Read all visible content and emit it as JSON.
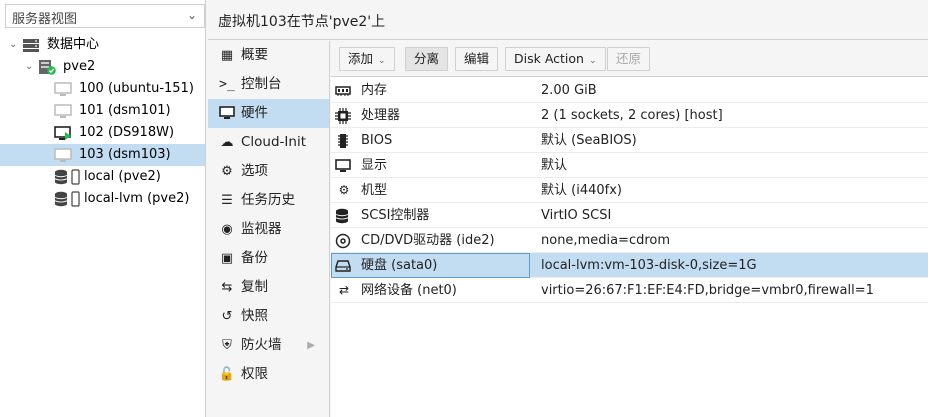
{
  "sidebar": {
    "view_select": "服务器视图",
    "tree": [
      {
        "label": "数据中心",
        "icon": "datacenter-icon",
        "level": 0,
        "expander": "minus"
      },
      {
        "label": "pve2",
        "icon": "node-online-icon",
        "level": 1,
        "expander": "minus"
      },
      {
        "label": "100 (ubuntu-151)",
        "icon": "vm-stopped-icon",
        "level": 2
      },
      {
        "label": "101 (dsm101)",
        "icon": "vm-stopped-icon",
        "level": 2
      },
      {
        "label": "102 (DS918W)",
        "icon": "vm-running-icon",
        "level": 2
      },
      {
        "label": "103 (dsm103)",
        "icon": "vm-stopped-icon",
        "level": 2,
        "selected": true
      },
      {
        "label": "local (pve2)",
        "icon": "storage-icon",
        "level": 2
      },
      {
        "label": "local-lvm (pve2)",
        "icon": "storage-icon",
        "level": 2
      }
    ]
  },
  "header": {
    "title": "虚拟机103在节点'pve2'上"
  },
  "nav": [
    {
      "label": "概要",
      "icon": "book-icon"
    },
    {
      "label": "控制台",
      "icon": "terminal-icon"
    },
    {
      "label": "硬件",
      "icon": "monitor-icon",
      "selected": true
    },
    {
      "label": "Cloud-Init",
      "icon": "cloud-icon"
    },
    {
      "label": "选项",
      "icon": "gear-icon"
    },
    {
      "label": "任务历史",
      "icon": "list-icon"
    },
    {
      "label": "监视器",
      "icon": "eye-icon"
    },
    {
      "label": "备份",
      "icon": "floppy-icon"
    },
    {
      "label": "复制",
      "icon": "retweet-icon"
    },
    {
      "label": "快照",
      "icon": "history-icon"
    },
    {
      "label": "防火墙",
      "icon": "shield-icon",
      "has_submenu": true
    },
    {
      "label": "权限",
      "icon": "unlock-icon"
    }
  ],
  "toolbar": {
    "add": "添加",
    "detach": "分离",
    "edit": "编辑",
    "disk_action": "Disk Action",
    "revert": "还原"
  },
  "hardware": [
    {
      "key": "内存",
      "value": "2.00 GiB",
      "icon": "memory-icon"
    },
    {
      "key": "处理器",
      "value": "2 (1 sockets, 2 cores) [host]",
      "icon": "cpu-icon"
    },
    {
      "key": "BIOS",
      "value": "默认 (SeaBIOS)",
      "icon": "microchip-icon"
    },
    {
      "key": "显示",
      "value": "默认",
      "icon": "desktop-icon"
    },
    {
      "key": "机型",
      "value": "默认 (i440fx)",
      "icon": "cogs-icon"
    },
    {
      "key": "SCSI控制器",
      "value": "VirtIO SCSI",
      "icon": "database-icon"
    },
    {
      "key": "CD/DVD驱动器 (ide2)",
      "value": "none,media=cdrom",
      "icon": "cdrom-icon"
    },
    {
      "key": "硬盘 (sata0)",
      "value": "local-lvm:vm-103-disk-0,size=1G",
      "icon": "hdd-icon",
      "selected": true
    },
    {
      "key": "网络设备 (net0)",
      "value": "virtio=26:67:F1:EF:E4:FD,bridge=vmbr0,firewall=1",
      "icon": "exchange-icon"
    }
  ],
  "colors": {
    "selection": "#c2ddf2",
    "running": "#21bf4b"
  }
}
